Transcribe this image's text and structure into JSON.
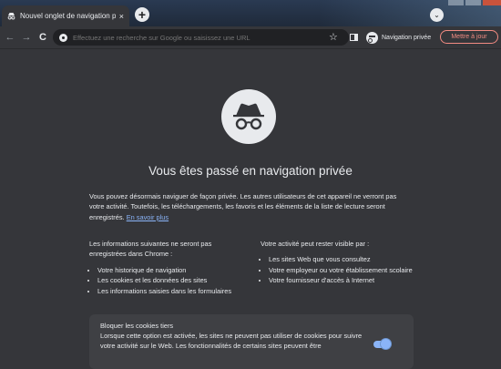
{
  "browser": {
    "tab_title": "Nouvel onglet de navigation privé",
    "new_tab_symbol": "+",
    "close_symbol": "×",
    "omnibox_placeholder": "Effectuez une recherche sur Google ou saisissez une URL",
    "incognito_label": "Navigation privée",
    "update_label": "Mettre à jour",
    "back_symbol": "←",
    "forward_symbol": "→",
    "reload_symbol": "C",
    "star_symbol": "☆",
    "tab_search_symbol": "⌄"
  },
  "page": {
    "headline": "Vous êtes passé en navigation privée",
    "intro_text": "Vous pouvez désormais naviguer de façon privée. Les autres utilisateurs de cet appareil ne verront pas votre activité. Toutefois, les téléchargements, les favoris et les éléments de la liste de lecture seront enregistrés.",
    "learn_more": "En savoir plus",
    "not_saved": {
      "heading": "Les informations suivantes ne seront pas enregistrées dans Chrome :",
      "items": [
        "Votre historique de navigation",
        "Les cookies et les données des sites",
        "Les informations saisies dans les formulaires"
      ]
    },
    "visible": {
      "heading": "Votre activité peut rester visible par :",
      "items": [
        "Les sites Web que vous consultez",
        "Votre employeur ou votre établissement scolaire",
        "Votre fournisseur d'accès à Internet"
      ]
    },
    "cookies": {
      "title": "Bloquer les cookies tiers",
      "description": "Lorsque cette option est activée, les sites ne peuvent pas utiliser de cookies pour suivre votre activité sur le Web. Les fonctionnalités de certains sites peuvent être"
    }
  },
  "icons": {
    "tab": "incognito-icon",
    "hero": "incognito-icon",
    "omnibox": "google-g-icon",
    "bookmark": "star-icon"
  },
  "colors": {
    "background": "#35363a",
    "link": "#8ab4f8",
    "update": "#f28b82",
    "toggle": "#8ab4f8"
  },
  "state": {
    "block_third_party_cookies": true
  }
}
